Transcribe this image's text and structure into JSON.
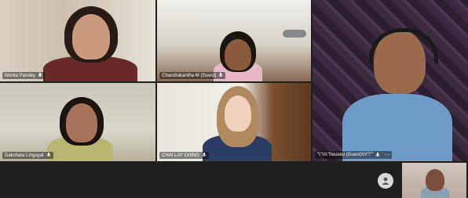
{
  "participants": [
    {
      "name": "Nimita Pandey"
    },
    {
      "name": "Chandrakantha M (Guest)"
    },
    {
      "name": "\"\\\"\\\\\\\\\"Seuseu (Guest)\\\\\\\\\"\\\"\""
    },
    {
      "name": "Dakshata Lingayat"
    },
    {
      "name": "CHAI LAY CHING"
    }
  ],
  "icons": {
    "mic": "microphone-icon",
    "more": "more-options-icon",
    "avatar": "person-icon"
  }
}
